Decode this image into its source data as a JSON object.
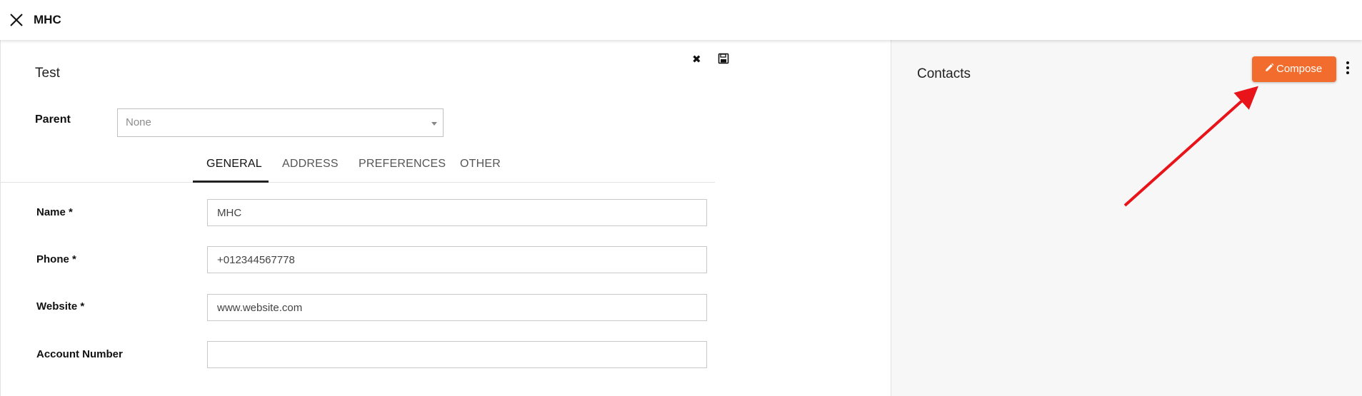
{
  "header": {
    "title": "MHC",
    "close_icon": "close-icon"
  },
  "record": {
    "title": "Test",
    "toolbar": {
      "cancel_icon": "times-icon",
      "save_icon": "floppy-disk-icon"
    },
    "parent": {
      "label": "Parent",
      "value": "None"
    },
    "tabs": [
      {
        "label": "GENERAL",
        "active": true
      },
      {
        "label": "ADDRESS",
        "active": false
      },
      {
        "label": "PREFERENCES",
        "active": false
      },
      {
        "label": "OTHER",
        "active": false
      }
    ],
    "fields": [
      {
        "label": "Name *",
        "value": "MHC"
      },
      {
        "label": "Phone *",
        "value": "+012344567778"
      },
      {
        "label": "Website *",
        "value": "www.website.com"
      },
      {
        "label": "Account Number",
        "value": ""
      }
    ]
  },
  "contacts": {
    "title": "Contacts",
    "compose_label": "Compose",
    "compose_icon": "pencil-icon",
    "more_icon": "vertical-ellipsis-icon"
  },
  "colors": {
    "accent": "#f26d2d",
    "annotation_arrow": "#e8141a",
    "side_panel_bg": "#f7f7f7"
  }
}
